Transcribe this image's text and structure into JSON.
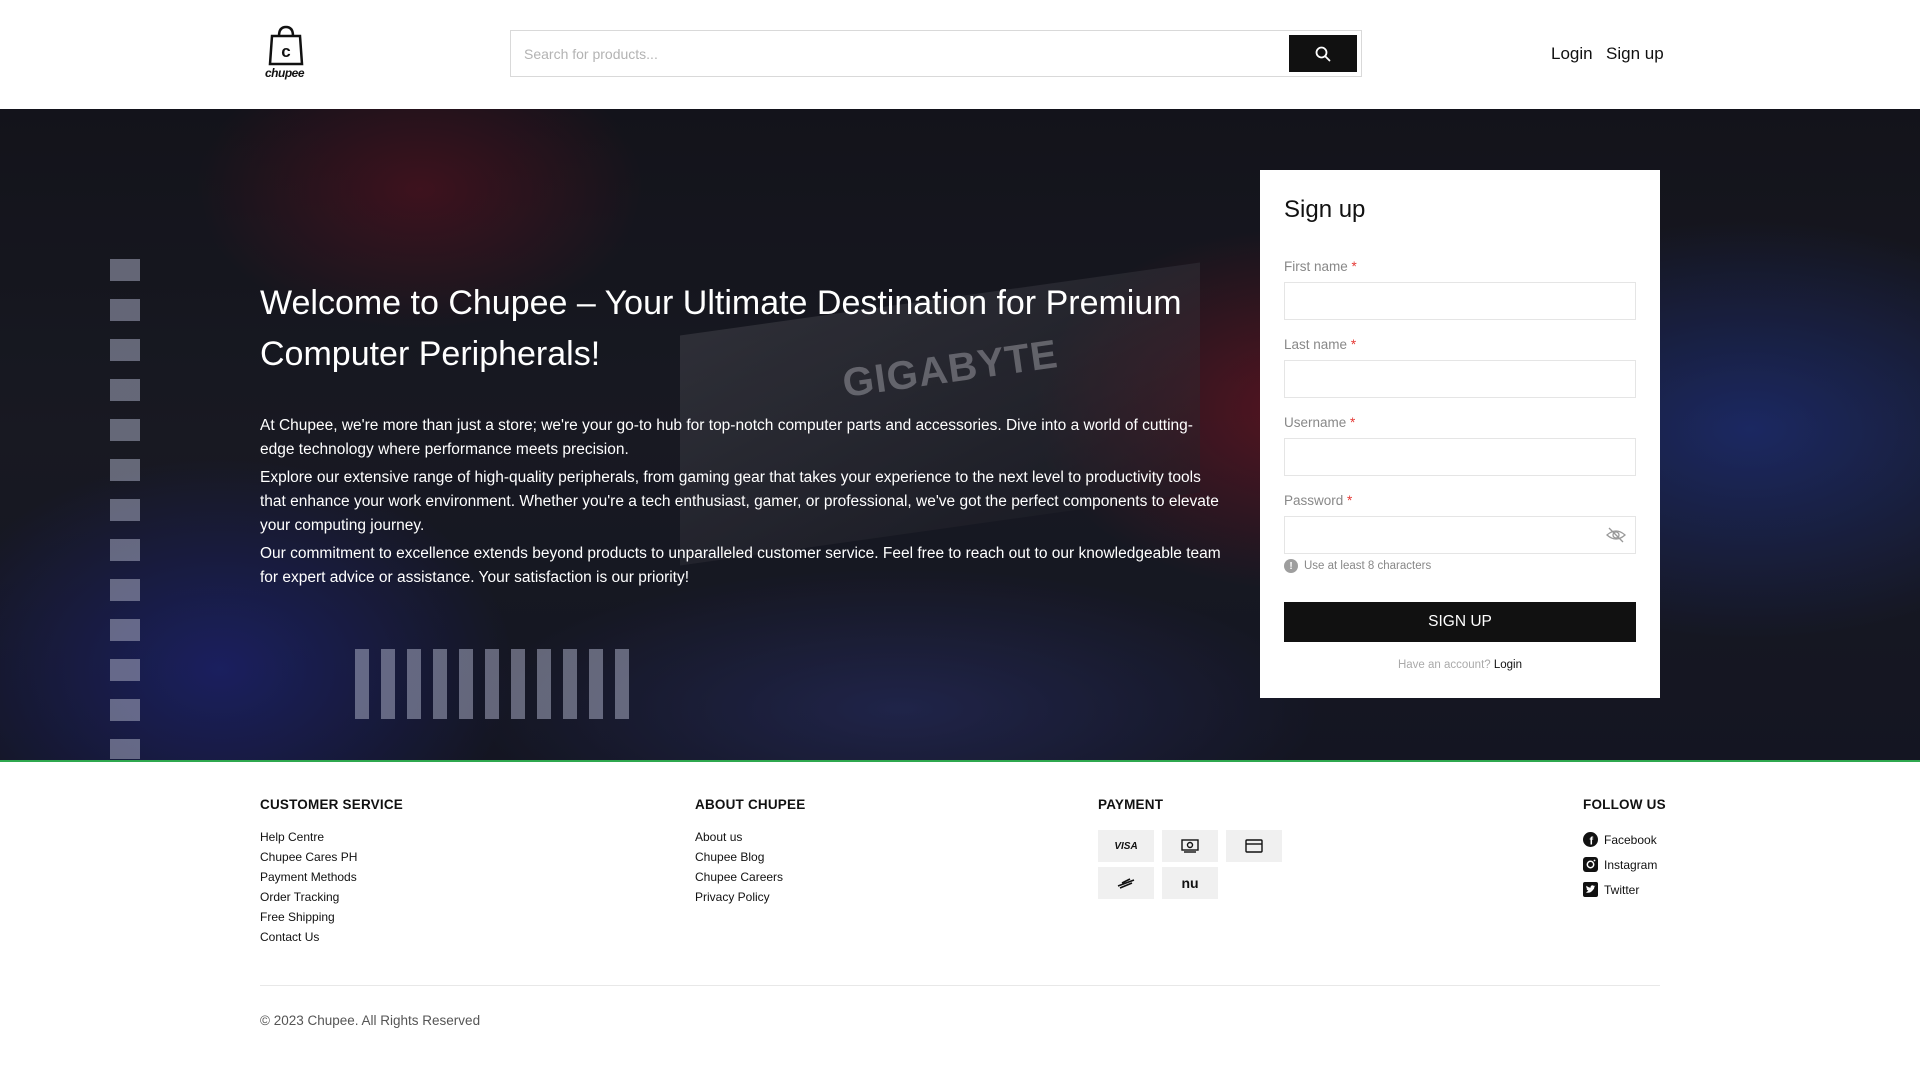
{
  "header": {
    "logo_text": "chupee",
    "search_placeholder": "Search for products...",
    "login_label": "Login",
    "signup_label": "Sign up"
  },
  "hero": {
    "background_brand_text": "GIGABYTE",
    "title": "Welcome to Chupee – Your Ultimate Destination for Premium Computer Peripherals!",
    "paragraphs": [
      "At Chupee, we're more than just a store; we're your go-to hub for top-notch computer parts and accessories. Dive into a world of cutting-edge technology where performance meets precision.",
      "Explore our extensive range of high-quality peripherals, from gaming gear that takes your experience to the next level to productivity tools that enhance your work environment. Whether you're a tech enthusiast, gamer, or professional, we've got the perfect components to elevate your computing journey.",
      "Our commitment to excellence extends beyond products to unparalleled customer service. Feel free to reach out to our knowledgeable team for expert advice or assistance. Your satisfaction is our priority!"
    ]
  },
  "signup_form": {
    "title": "Sign up",
    "required_mark": "*",
    "first_name_label": "First name",
    "last_name_label": "Last name",
    "username_label": "Username",
    "password_label": "Password",
    "password_hint": "Use at least 8 characters",
    "hint_icon": "!",
    "submit_label": "SIGN UP",
    "have_account_text": "Have an account?",
    "login_link": "Login"
  },
  "footer": {
    "customer_service": {
      "heading": "CUSTOMER SERVICE",
      "links": [
        "Help Centre",
        "Chupee Cares PH",
        "Payment Methods",
        "Order Tracking",
        "Free Shipping",
        "Contact Us"
      ]
    },
    "about": {
      "heading": "ABOUT CHUPEE",
      "links": [
        "About us",
        "Chupee Blog",
        "Chupee Careers",
        "Privacy Policy"
      ]
    },
    "payment": {
      "heading": "PAYMENT",
      "visa_label": "VISA",
      "methods": [
        "visa-icon",
        "cash-icon",
        "card-icon",
        "wave-icon",
        "nu-icon"
      ],
      "nu_label": "nu"
    },
    "follow": {
      "heading": "FOLLOW US",
      "links": [
        "Facebook",
        "Instagram",
        "Twitter"
      ]
    },
    "copyright": "© 2023 Chupee. All Rights Reserved"
  },
  "colors": {
    "accent_dark": "#111111",
    "required_red": "#e53935",
    "hero_bottom_line": "#2fa84f"
  }
}
